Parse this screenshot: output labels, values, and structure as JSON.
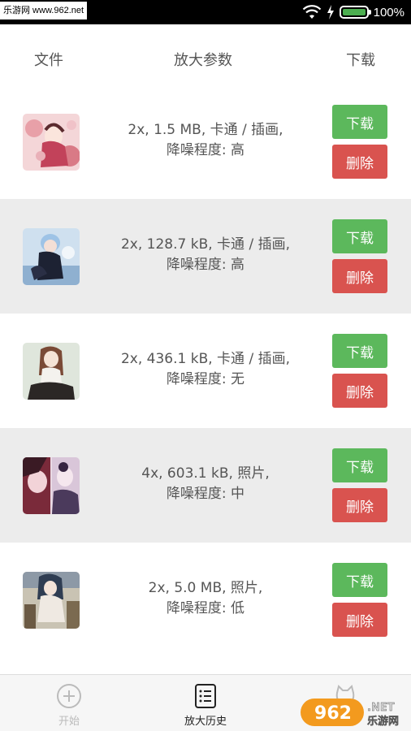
{
  "status_bar": {
    "watermark_text": "乐游网 www.962.net",
    "battery_text": "100%",
    "battery_level": 1.0
  },
  "table_header": {
    "file": "文件",
    "params": "放大参数",
    "download": "下载"
  },
  "rows": [
    {
      "line1": "2x, 1.5 MB, 卡通 / 插画,",
      "line2": "降噪程度: 高",
      "download_label": "下载",
      "delete_label": "删除"
    },
    {
      "line1": "2x, 128.7 kB, 卡通 / 插画,",
      "line2": "降噪程度: 高",
      "download_label": "下载",
      "delete_label": "删除"
    },
    {
      "line1": "2x, 436.1 kB, 卡通 / 插画,",
      "line2": "降噪程度: 无",
      "download_label": "下载",
      "delete_label": "删除"
    },
    {
      "line1": "4x, 603.1 kB, 照片,",
      "line2": "降噪程度: 中",
      "download_label": "下载",
      "delete_label": "删除"
    },
    {
      "line1": "2x, 5.0 MB, 照片,",
      "line2": "降噪程度: 低",
      "download_label": "下载",
      "delete_label": "删除"
    }
  ],
  "bottom_nav": {
    "start": {
      "label": "开始",
      "icon": "plus-circle-icon"
    },
    "history": {
      "label": "放大历史",
      "icon": "list-icon"
    },
    "third": {
      "icon": "cat-icon"
    }
  },
  "corner_watermark": {
    "text_962": "962",
    "text_net": ".NET",
    "text_cn": "乐游网"
  },
  "colors": {
    "download_button": "#5cb85c",
    "delete_button": "#d9534f",
    "alt_row": "#ececec"
  }
}
